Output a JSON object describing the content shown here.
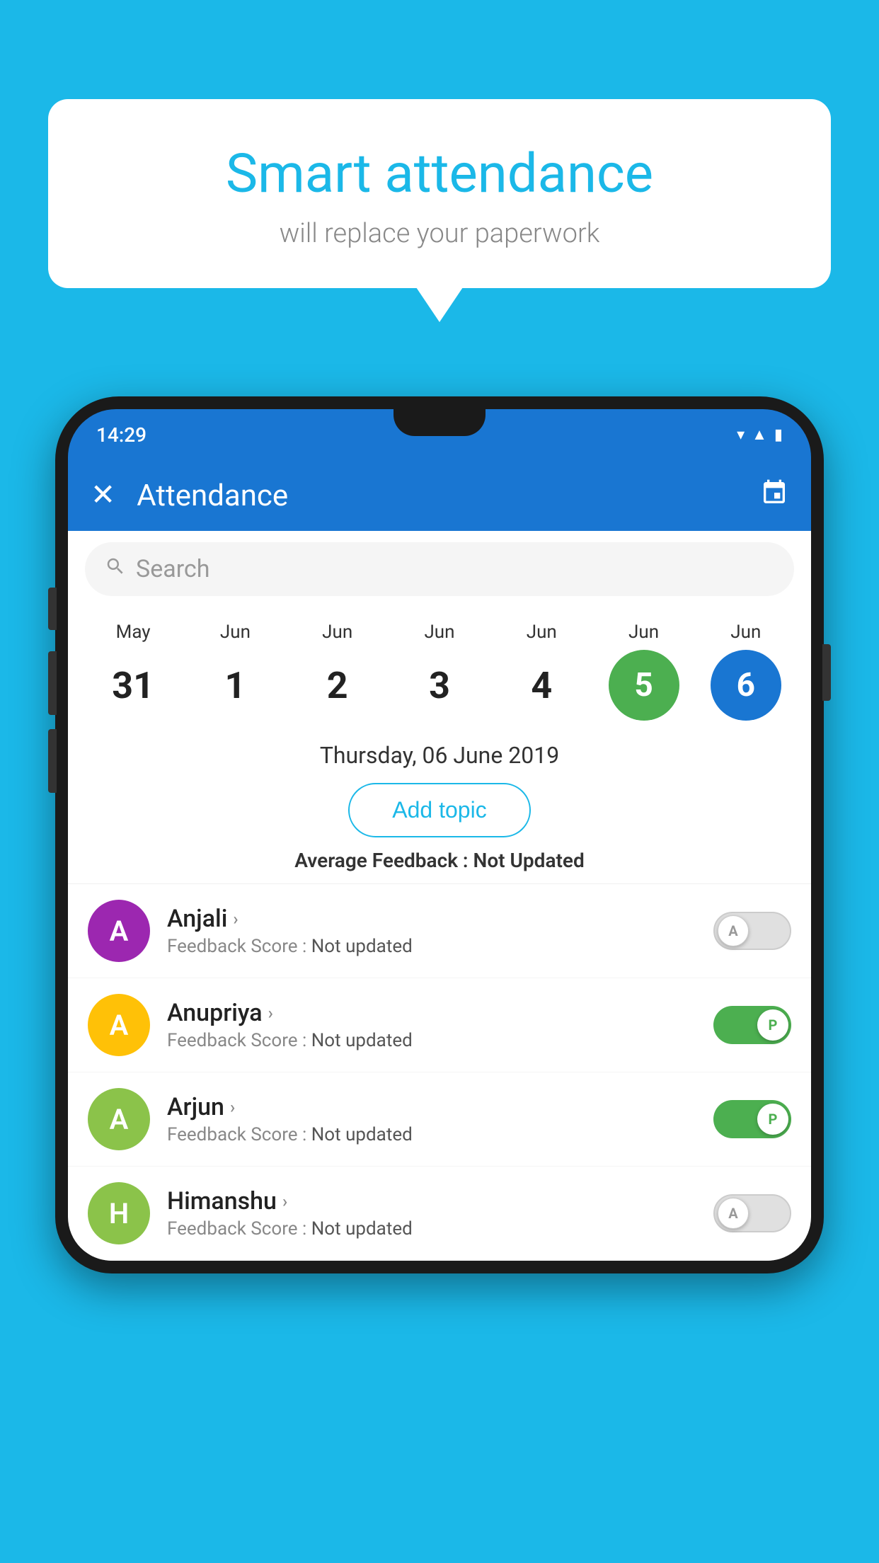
{
  "background_color": "#1bb8e8",
  "bubble": {
    "title": "Smart attendance",
    "subtitle": "will replace your paperwork"
  },
  "status_bar": {
    "time": "14:29",
    "wifi_icon": "▼",
    "signal_icon": "▲",
    "battery_icon": "▮"
  },
  "app_bar": {
    "close_label": "✕",
    "title": "Attendance",
    "calendar_icon": "📅"
  },
  "search": {
    "placeholder": "Search"
  },
  "dates": [
    {
      "month": "May",
      "day": "31",
      "style": "normal"
    },
    {
      "month": "Jun",
      "day": "1",
      "style": "normal"
    },
    {
      "month": "Jun",
      "day": "2",
      "style": "normal"
    },
    {
      "month": "Jun",
      "day": "3",
      "style": "normal"
    },
    {
      "month": "Jun",
      "day": "4",
      "style": "normal"
    },
    {
      "month": "Jun",
      "day": "5",
      "style": "green"
    },
    {
      "month": "Jun",
      "day": "6",
      "style": "blue"
    }
  ],
  "selected_date": "Thursday, 06 June 2019",
  "add_topic_label": "Add topic",
  "avg_feedback_label": "Average Feedback :",
  "avg_feedback_value": "Not Updated",
  "students": [
    {
      "name": "Anjali",
      "avatar_letter": "A",
      "avatar_color": "#9c27b0",
      "feedback_label": "Feedback Score :",
      "feedback_value": "Not updated",
      "toggle_state": "off",
      "toggle_letter": "A"
    },
    {
      "name": "Anupriya",
      "avatar_letter": "A",
      "avatar_color": "#ffc107",
      "feedback_label": "Feedback Score :",
      "feedback_value": "Not updated",
      "toggle_state": "on",
      "toggle_letter": "P"
    },
    {
      "name": "Arjun",
      "avatar_letter": "A",
      "avatar_color": "#8bc34a",
      "feedback_label": "Feedback Score :",
      "feedback_value": "Not updated",
      "toggle_state": "on",
      "toggle_letter": "P"
    },
    {
      "name": "Himanshu",
      "avatar_letter": "H",
      "avatar_color": "#8bc34a",
      "feedback_label": "Feedback Score :",
      "feedback_value": "Not updated",
      "toggle_state": "off",
      "toggle_letter": "A"
    }
  ]
}
